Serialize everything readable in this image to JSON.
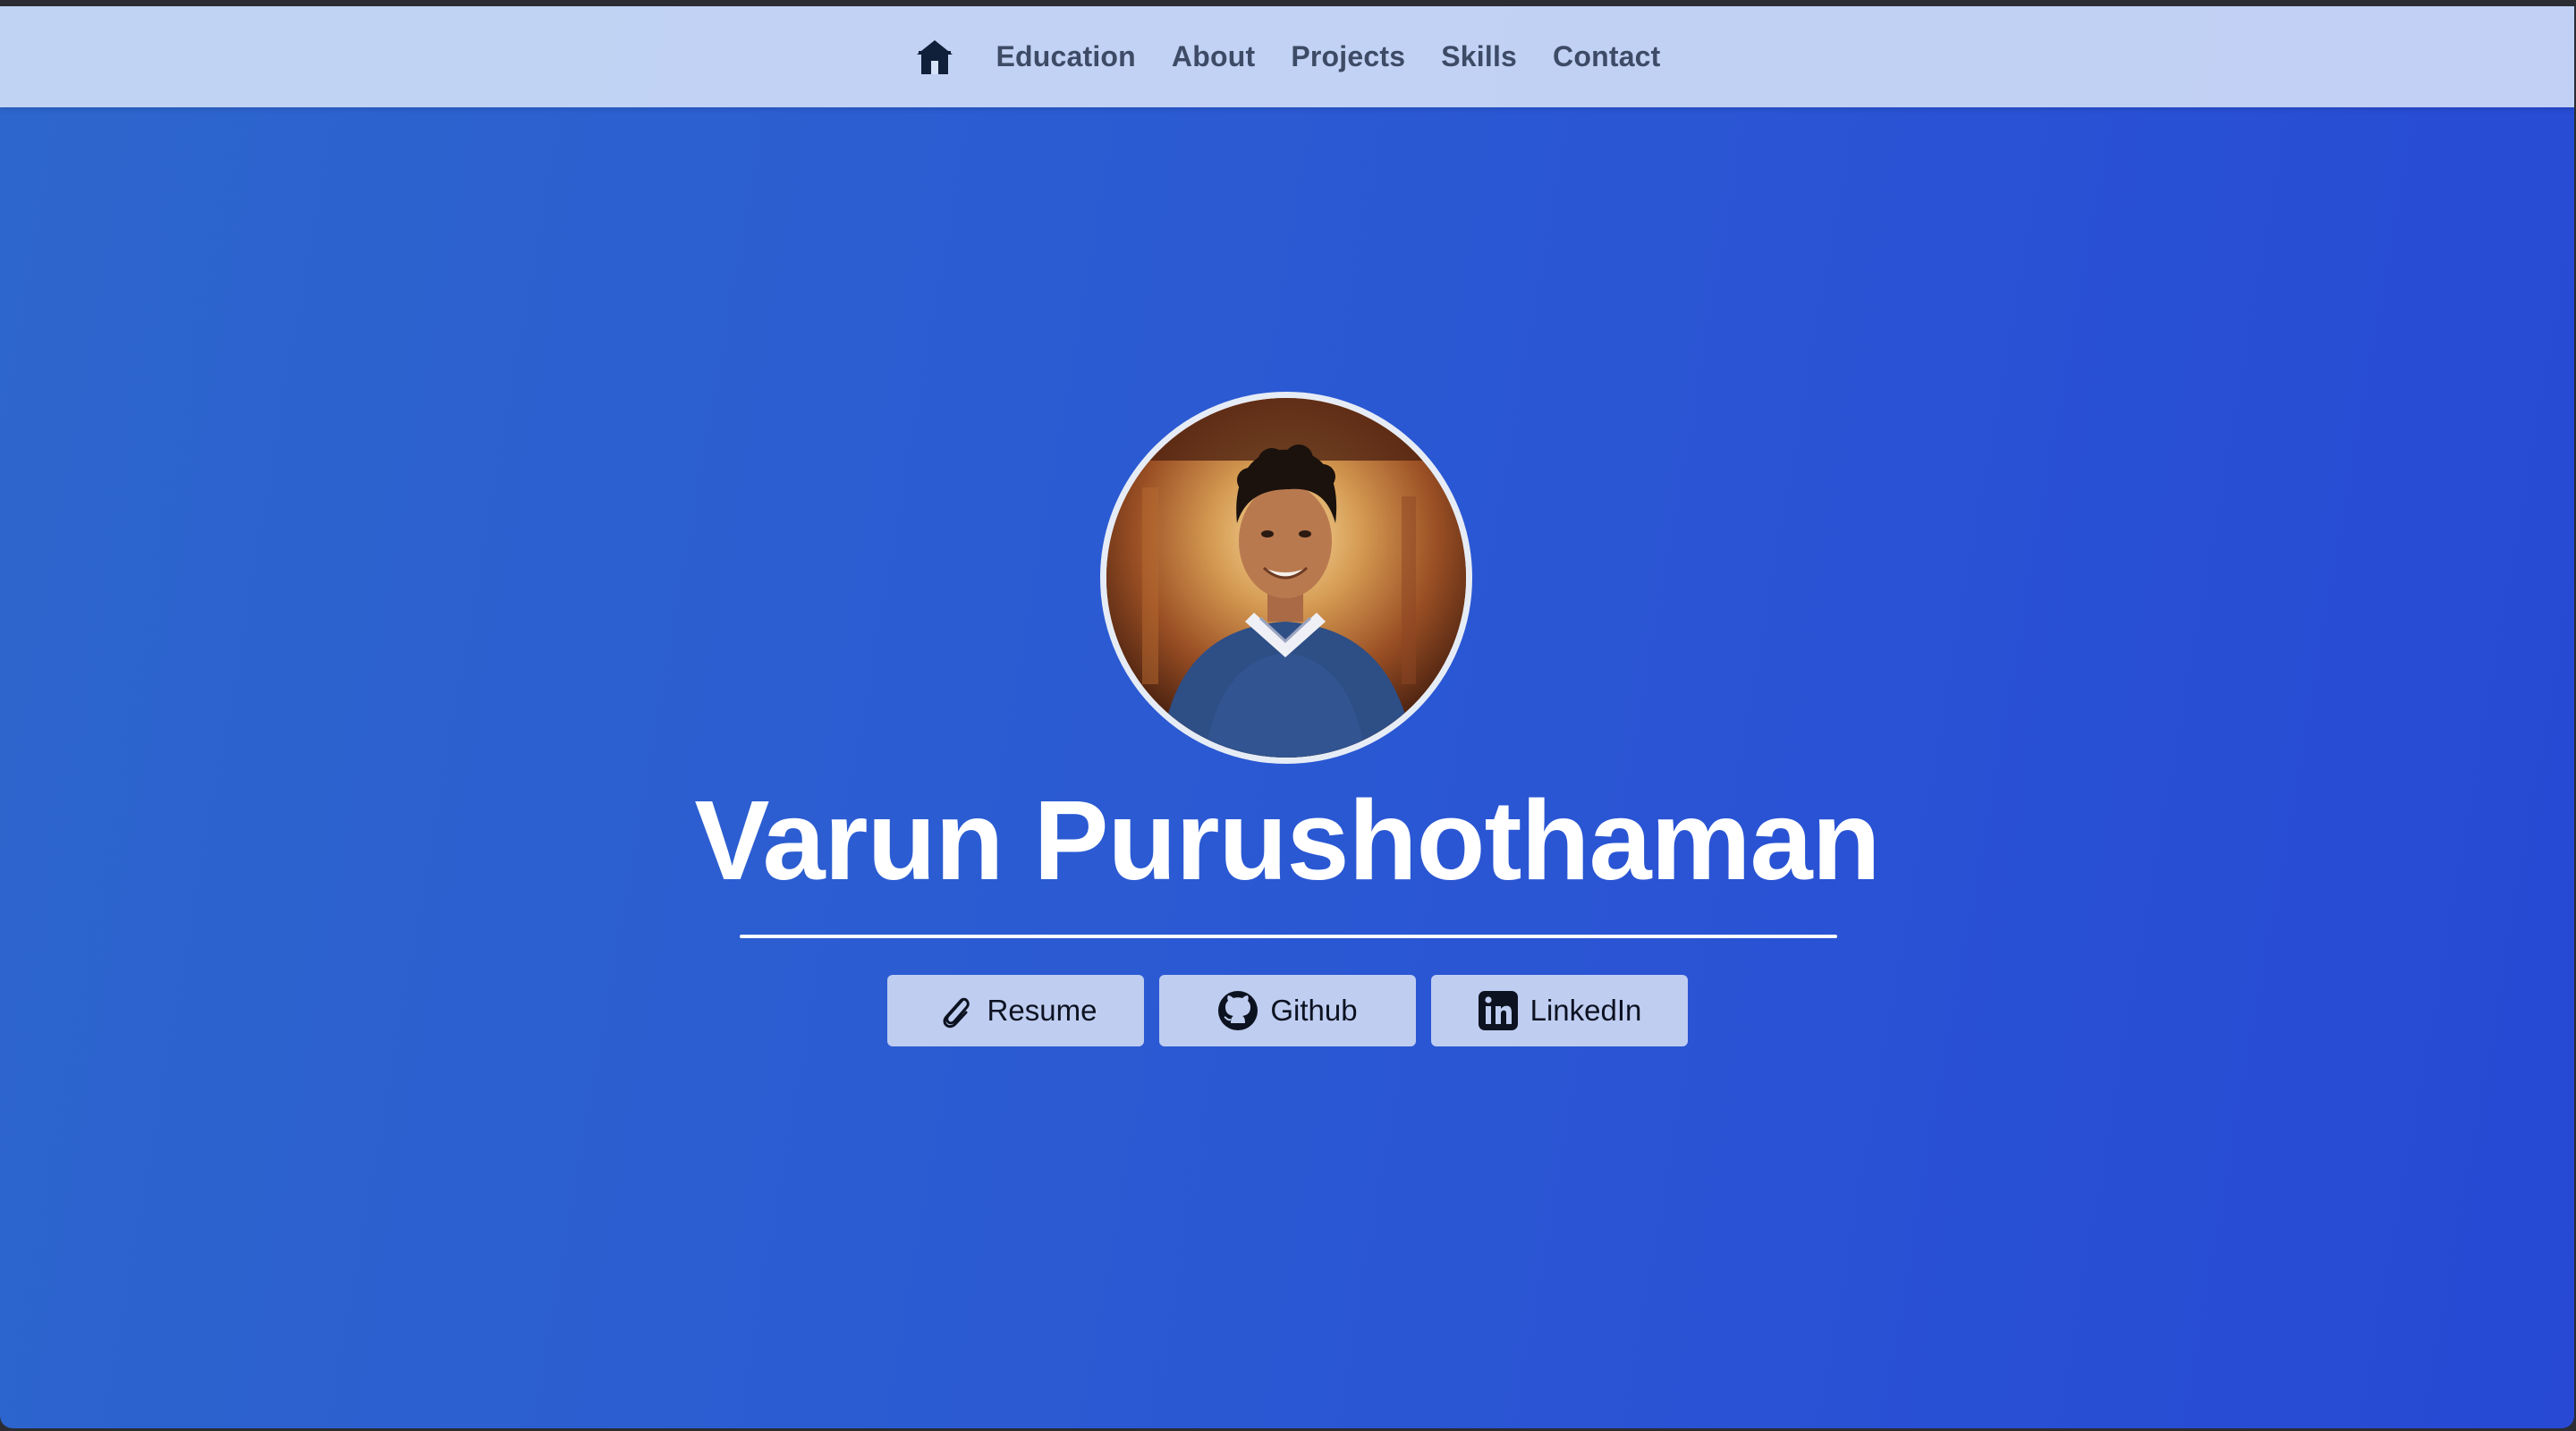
{
  "nav": {
    "home_icon": "home-icon",
    "items": [
      {
        "label": "Education"
      },
      {
        "label": "About"
      },
      {
        "label": "Projects"
      },
      {
        "label": "Skills"
      },
      {
        "label": "Contact"
      }
    ]
  },
  "hero": {
    "name": "Varun Purushothaman",
    "buttons": [
      {
        "label": "Resume",
        "icon": "paperclip-icon"
      },
      {
        "label": "Github",
        "icon": "github-icon"
      },
      {
        "label": "LinkedIn",
        "icon": "linkedin-icon"
      }
    ]
  },
  "colors": {
    "nav_bg": "#d6e2f8",
    "nav_text": "#3e4b66",
    "hero_gradient_start": "#2d66cc",
    "hero_gradient_end": "#2749d4",
    "button_bg": "#bfcdf1",
    "title_text": "#ffffff"
  }
}
